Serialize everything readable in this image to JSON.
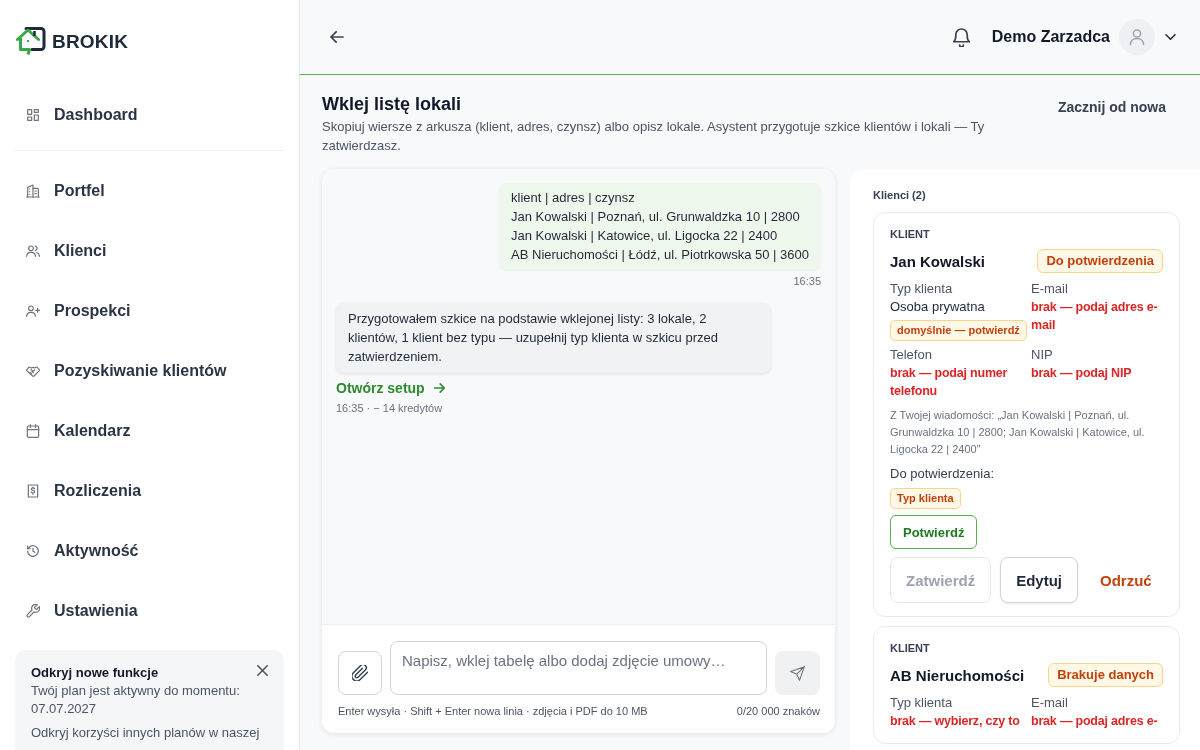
{
  "sidebar": {
    "brand": "BROKIK",
    "nav_groups": [
      {
        "items": [
          {
            "label": "Dashboard",
            "selected": false
          }
        ]
      },
      {
        "items": [
          {
            "label": "Portfel",
            "selected": false
          },
          {
            "label": "Klienci",
            "selected": false
          },
          {
            "label": "Prospekci",
            "selected": false
          },
          {
            "label": "Pozyskiwanie klientów",
            "selected": false
          },
          {
            "label": "Kalendarz",
            "selected": false
          },
          {
            "label": "Rozliczenia",
            "selected": false
          },
          {
            "label": "Aktywność",
            "selected": false
          },
          {
            "label": "Ustawienia",
            "selected": false
          }
        ]
      }
    ],
    "promo": {
      "title": "Odkryj nowe funkcje",
      "text": "Twój plan jest aktywny do momentu: 07.07.2027",
      "more": "Odkryj korzyści innych planów w naszej"
    }
  },
  "topbar": {
    "user_name": "Demo Zarzadca"
  },
  "page": {
    "title": "Wklej listę lokali",
    "subtitle": "Skopiuj wiersze z arkusza (klient, adres, czynsz) albo opisz lokale. Asystent przygotuje szkice klientów i lokali — Ty zatwierdzasz.",
    "reset": "Zacznij od nowa"
  },
  "chat": {
    "messages": [
      {
        "kind": "user",
        "text": "klient | adres | czynsz\nJan Kowalski | Poznań, ul. Grunwaldzka 10 | 2800\nJan Kowalski | Katowice, ul. Ligocka 22 | 2400\nAB Nieruchomości | Łódź, ul. Piotrkowska 50 | 3600",
        "time": "16:35"
      },
      {
        "kind": "assistant",
        "text": "Przygotowałem szkice na podstawie wklejonej listy: 3 lokale, 2 klientów, 1 klient bez typu — uzupełnij typ klienta w szkicu przed zatwierdzeniem.",
        "link": "Otwórz setup",
        "time": "16:35 · − 14 kredytów"
      }
    ],
    "composer": {
      "placeholder": "Napisz, wklej tabelę albo dodaj zdjęcie umowy…",
      "send_button": {
        "disabled": true
      },
      "hint": "Enter wysyła · Shift + Enter nowa linia · zdjęcia i PDF do 10 MB",
      "counter": "0/20 000 znaków"
    }
  },
  "clients_panel": {
    "heading": "Klienci (2)",
    "clients": [
      {
        "kicker": "KLIENT",
        "name": "Jan Kowalski",
        "status": "Do potwierdzenia",
        "fields": [
          {
            "label": "Typ klienta",
            "value": "Osoba prywatna",
            "missing": false,
            "tag": "domyślnie — potwierdź"
          },
          {
            "label": "E-mail",
            "value": "brak — podaj adres e-mail",
            "missing": true
          },
          {
            "label": "Telefon",
            "value": "brak — podaj numer telefonu",
            "missing": true
          },
          {
            "label": "NIP",
            "value": "brak — podaj NIP",
            "missing": true
          }
        ],
        "source": "Z Twojej wiadomości: „Jan Kowalski | Poznań, ul. Grunwaldzka 10 | 2800; Jan Kowalski | Katowice, ul. Ligocka 22 | 2400”",
        "pending_label": "Do potwierdzenia:",
        "pending_tags": [
          "Typ klienta"
        ],
        "confirm": "Potwierdź",
        "actions": [
          {
            "kind": "outline",
            "label": "Zatwierdź",
            "disabled": true
          },
          {
            "kind": "outline",
            "label": "Edytuj",
            "disabled": false
          },
          {
            "kind": "danger",
            "label": "Odrzuć",
            "disabled": false
          }
        ]
      },
      {
        "kicker": "KLIENT",
        "name": "AB Nieruchomości",
        "status": "Brakuje danych",
        "fields": [
          {
            "label": "Typ klienta",
            "value": "brak — wybierz, czy to",
            "missing": true
          },
          {
            "label": "E-mail",
            "value": "brak — podaj adres e-",
            "missing": true
          }
        ]
      }
    ]
  }
}
